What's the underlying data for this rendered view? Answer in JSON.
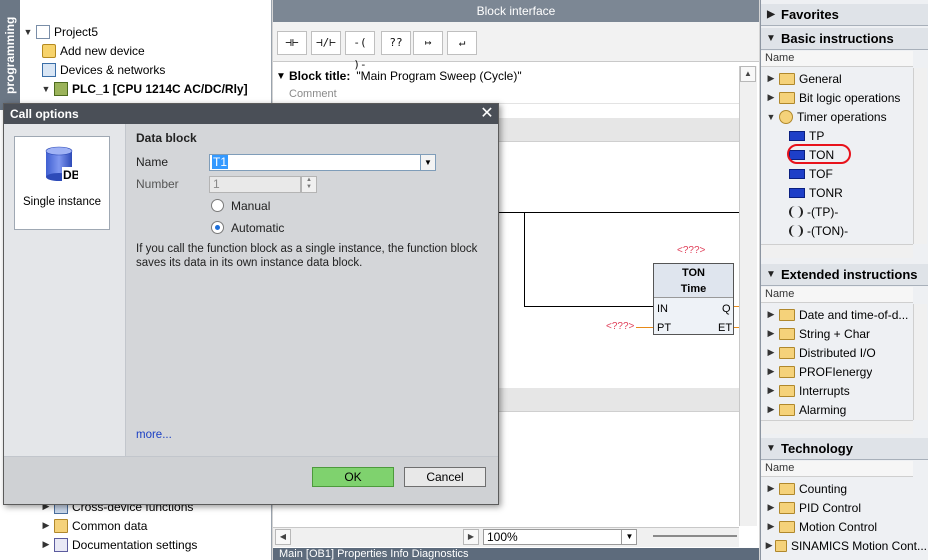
{
  "left_panel": {
    "vertical_tab": "programming",
    "tree": [
      {
        "label": "Project5",
        "icon": "project-icon",
        "toggle": "▼"
      },
      {
        "label": "Add new device",
        "icon": "add-device-icon",
        "toggle": ""
      },
      {
        "label": "Devices & networks",
        "icon": "network-icon",
        "toggle": ""
      },
      {
        "label": "PLC_1 [CPU 1214C AC/DC/Rly]",
        "icon": "plc-icon",
        "toggle": "▼"
      },
      {
        "label": "Cross-device functions",
        "icon": "cross-device-icon",
        "toggle": "▶"
      },
      {
        "label": "Common data",
        "icon": "folder-icon",
        "toggle": "▶"
      },
      {
        "label": "Documentation settings",
        "icon": "doc-icon",
        "toggle": "▶"
      }
    ]
  },
  "editor": {
    "header": "Block interface",
    "toolbar": [
      "⊣⊢",
      "⊣/⊢",
      "-( )-",
      "??",
      "↦",
      "↵"
    ],
    "block_title_label": "Block title:",
    "block_title_value": "\"Main Program Sweep (Cycle)\"",
    "comment": "Comment",
    "ton": {
      "title": "TON",
      "subtitle": "Time",
      "pin_in": "IN",
      "pin_pt": "PT",
      "pin_q": "Q",
      "pin_et": "ET",
      "instance_placeholder": "<???>",
      "pt_placeholder": "<???>"
    },
    "zoom": "100%",
    "bottom_tabs": "Main [OB1]      Properties      Info      Diagnostics"
  },
  "dialog": {
    "title": "Call options",
    "tile_label": "Single instance",
    "tile_icon": "DB",
    "section": "Data block",
    "name_label": "Name",
    "name_value": "T1",
    "number_label": "Number",
    "number_value": "1",
    "radio_manual": "Manual",
    "radio_automatic": "Automatic",
    "selected_mode": "Automatic",
    "info": "If you call the function block as a single instance, the function block saves its data in its own instance data block.",
    "more": "more...",
    "ok": "OK",
    "cancel": "Cancel"
  },
  "right_panel": {
    "favorites": "Favorites",
    "basic": {
      "title": "Basic instructions",
      "col": "Name",
      "items": [
        {
          "label": "General",
          "type": "folder",
          "toggle": "▶"
        },
        {
          "label": "Bit logic operations",
          "type": "folder",
          "toggle": "▶"
        },
        {
          "label": "Timer operations",
          "type": "timer",
          "toggle": "▼"
        },
        {
          "label": "TP",
          "type": "instruction"
        },
        {
          "label": "TON",
          "type": "instruction"
        },
        {
          "label": "TOF",
          "type": "instruction"
        },
        {
          "label": "TONR",
          "type": "instruction"
        },
        {
          "label": "-(TP)-",
          "type": "coil"
        },
        {
          "label": "-(TON)-",
          "type": "coil"
        }
      ]
    },
    "extended": {
      "title": "Extended instructions",
      "col": "Name",
      "items": [
        "Date and time-of-d...",
        "String + Char",
        "Distributed I/O",
        "PROFIenergy",
        "Interrupts",
        "Alarming"
      ]
    },
    "technology": {
      "title": "Technology",
      "col": "Name",
      "items": [
        "Counting",
        "PID Control",
        "Motion Control",
        "SINAMICS Motion Cont..."
      ]
    }
  },
  "colors": {
    "highlight_circle": "#e8121b",
    "ok_button": "#7fd26e",
    "placeholder": "#e0405a"
  }
}
